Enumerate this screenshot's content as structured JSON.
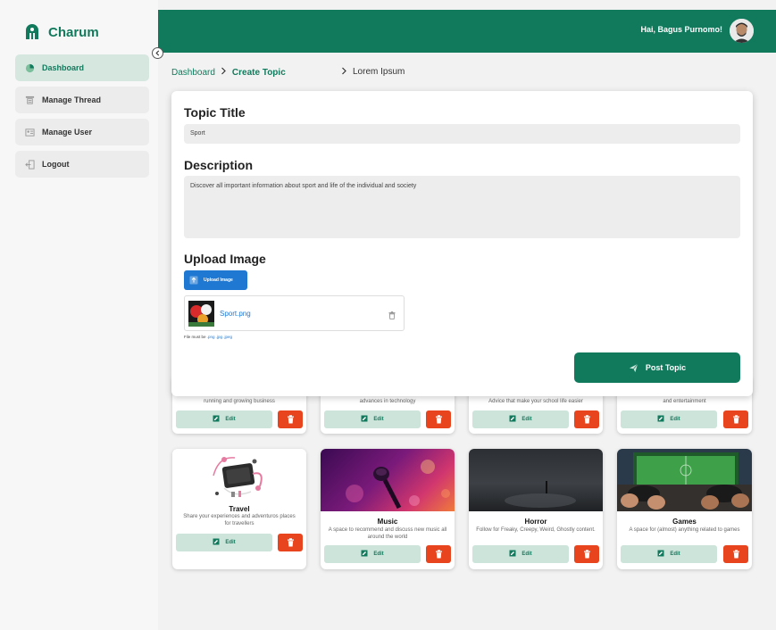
{
  "app": {
    "name": "Charum",
    "brand_color": "#127a5c"
  },
  "sidebar": {
    "items": [
      {
        "label": "Dashboard",
        "icon": "pie-chart-icon",
        "active": true
      },
      {
        "label": "Manage Thread",
        "icon": "thread-icon",
        "active": false
      },
      {
        "label": "Manage User",
        "icon": "user-card-icon",
        "active": false
      },
      {
        "label": "Logout",
        "icon": "logout-icon",
        "active": false
      }
    ]
  },
  "header": {
    "greeting": "Hai, Bagus Purnomo!"
  },
  "breadcrumb": {
    "root": "Dashboard",
    "current": "Create Topic",
    "extra": "Lorem Ipsum"
  },
  "modal": {
    "title_label": "Topic Title",
    "title_value": "Sport",
    "description_label": "Description",
    "description_value": "Discover all important information about sport and  life of the individual and society",
    "upload_label": "Upload Image",
    "upload_button": "Upload Image",
    "file_name": "Sport.png",
    "file_hint_prefix": "File must be",
    "file_hint_formats": ".png .jpg .jpeg",
    "post_button": "Post Topic"
  },
  "cards_row1": [
    {
      "desc": "running and growing business",
      "edit": "Edit"
    },
    {
      "desc": "advances in technology",
      "edit": "Edit"
    },
    {
      "desc": "Advice that make your school life easier",
      "edit": "Edit"
    },
    {
      "desc": "and entertainment",
      "edit": "Edit"
    }
  ],
  "cards_row2": [
    {
      "title": "Travel",
      "desc": "Share your experiences and adventuros places for travellers",
      "edit": "Edit"
    },
    {
      "title": "Music",
      "desc": "A space to recommend and discuss new music all around the world",
      "edit": "Edit"
    },
    {
      "title": "Horror",
      "desc": "Follow for Freaky, Creepy, Weird, Ghostly content.",
      "edit": "Edit"
    },
    {
      "title": "Games",
      "desc": "A space for (almost) anything related to games",
      "edit": "Edit"
    }
  ],
  "colors": {
    "primary": "#127a5c",
    "danger": "#e8451e",
    "upload": "#1f79d3",
    "edit_bg": "#cde4db"
  }
}
